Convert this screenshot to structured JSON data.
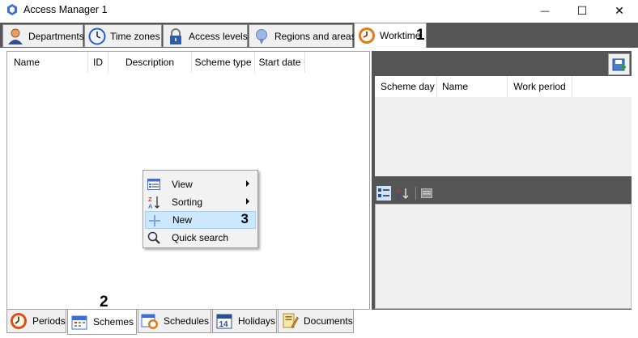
{
  "window": {
    "title": "Access Manager 1",
    "minimize_glyph": "—",
    "maximize_glyph": "☐",
    "close_glyph": "✕"
  },
  "top_tabs": [
    {
      "label": "Departments",
      "icon": "person-icon"
    },
    {
      "label": "Time zones",
      "icon": "clock-icon"
    },
    {
      "label": "Access levels",
      "icon": "padlock-icon"
    },
    {
      "label": "Regions and areas",
      "icon": "pin-icon"
    },
    {
      "label": "Worktime",
      "icon": "worktime-clock-icon",
      "active": true
    }
  ],
  "schemes_table": {
    "columns": [
      "Name",
      "ID",
      "Description",
      "Scheme type",
      "Start date"
    ]
  },
  "scheme_days_table": {
    "columns": [
      "Scheme day",
      "Name",
      "Work period"
    ]
  },
  "context_menu": {
    "items": [
      {
        "label": "View",
        "icon": "view-icon",
        "submenu": true
      },
      {
        "label": "Sorting",
        "icon": "sort-icon",
        "submenu": true
      },
      {
        "label": "New",
        "icon": "plus-icon",
        "highlighted": true
      },
      {
        "label": "Quick search",
        "icon": "magnifier-icon"
      }
    ]
  },
  "bottom_tabs": [
    {
      "label": "Periods",
      "icon": "periods-icon"
    },
    {
      "label": "Schemes",
      "icon": "calendar-icon",
      "active": true
    },
    {
      "label": "Schedules",
      "icon": "schedule-icon"
    },
    {
      "label": "Holidays",
      "icon": "holiday-calendar-icon",
      "date_number": "14"
    },
    {
      "label": "Documents",
      "icon": "document-icon"
    }
  ],
  "callouts": [
    "1",
    "2",
    "3"
  ],
  "colors": {
    "dark_band": "#555555",
    "panel_gray": "#f0f0f0",
    "highlight": "#cce8ff"
  }
}
